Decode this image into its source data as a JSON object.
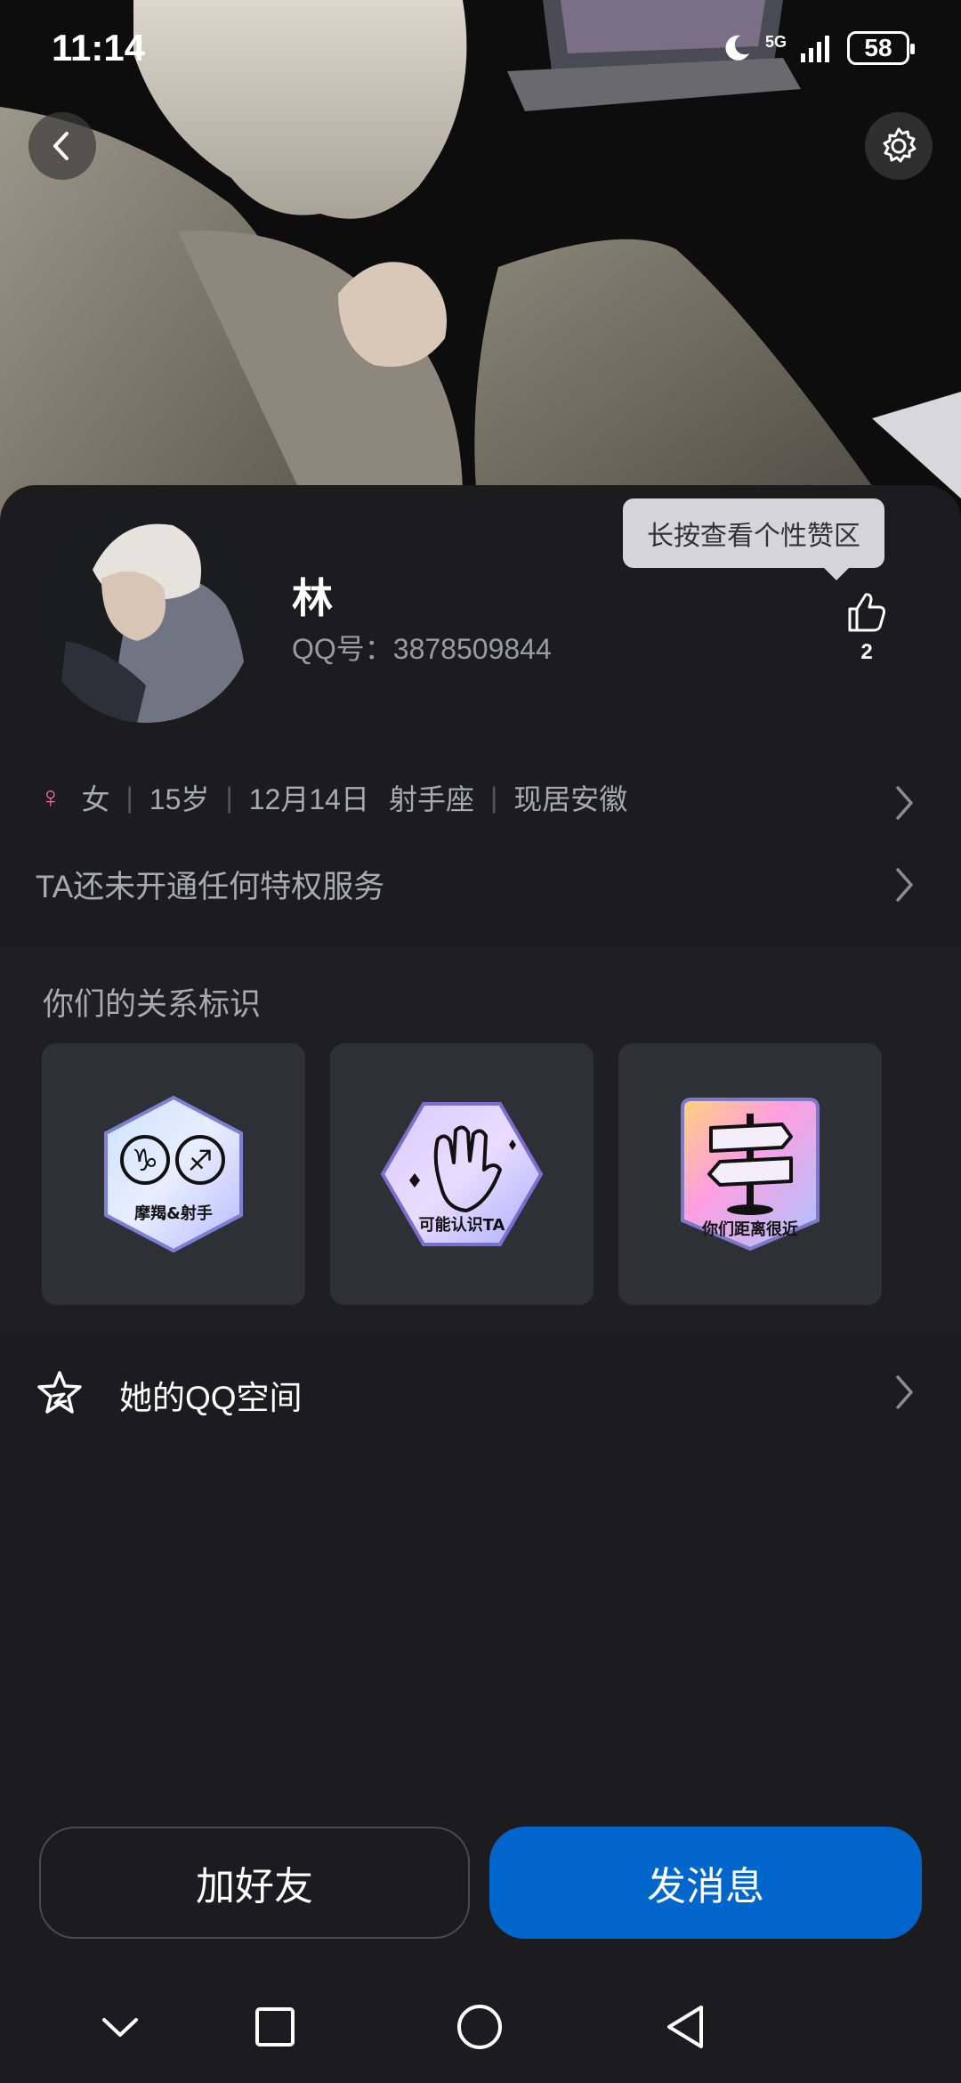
{
  "status_bar": {
    "time": "11:14",
    "network": "5G",
    "battery": "58"
  },
  "profile": {
    "name": "林",
    "qq_line": "QQ号：3878509844",
    "like_tooltip": "长按查看个性赞区",
    "like_count": "2"
  },
  "info": {
    "gender": "女",
    "age": "15岁",
    "birthday": "12月14日",
    "zodiac": "射手座",
    "location": "现居安徽",
    "privilege": "TA还未开通任何特权服务"
  },
  "relations": {
    "title": "你们的关系标识",
    "badges": [
      {
        "label": "摩羯&射手",
        "icon": "zodiac-badge-icon"
      },
      {
        "label": "可能认识TA",
        "icon": "wave-hand-badge-icon"
      },
      {
        "label": "你们距离很近",
        "icon": "signpost-badge-icon"
      }
    ]
  },
  "qzone": {
    "label": "她的QQ空间"
  },
  "actions": {
    "add_friend": "加好友",
    "send_message": "发消息"
  },
  "colors": {
    "primary": "#0066cc",
    "background": "#1c1c1e",
    "gender_female": "#e86ca0"
  }
}
